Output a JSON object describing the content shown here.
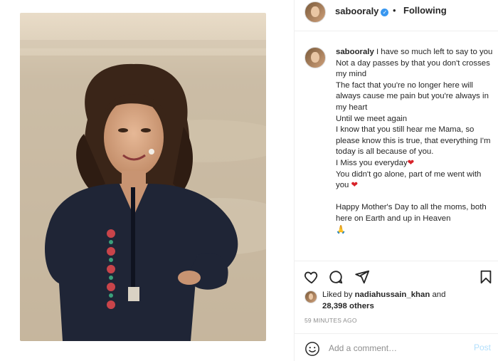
{
  "post": {
    "username": "sabooraly",
    "verified_mark": "✓",
    "separator": "•",
    "follow_status": "Following",
    "caption_username": "sabooraly",
    "caption_text": " I have so much left to say to you\nNot a day passes by that you don't crosses my mind\nThe fact that you're no longer here will always cause me pain but you're always in my heart\nUntil we meet again\nI know that you still hear me Mama, so please know this is true, that everything I'm today is all because of you.\nI Miss you everyday",
    "caption_heart_1": "❤",
    "caption_text_2": "\nYou didn't go alone, part of me went with you ",
    "caption_heart_2": "❤",
    "caption_text_3": "\n\nHappy Mother's Day to all the moms, both here on Earth and up in Heaven\n",
    "caption_emoji_end": "🙏",
    "likes_prefix": "Liked by ",
    "likes_user": "nadiahussain_khan",
    "likes_mid": " and",
    "likes_count": "28,398 others",
    "timestamp": "59 minutes ago"
  },
  "actions": {
    "like": "heart-icon",
    "comment": "comment-icon",
    "share": "share-icon",
    "save": "bookmark-icon"
  },
  "comment_box": {
    "placeholder": "Add a comment…",
    "post_label": "Post",
    "emoji_icon": "smiley-icon"
  },
  "colors": {
    "link_blue": "#3897f0",
    "post_button_disabled": "#b2dffc",
    "heart_red": "#d8232a",
    "muted_text": "#8e8e8e"
  }
}
